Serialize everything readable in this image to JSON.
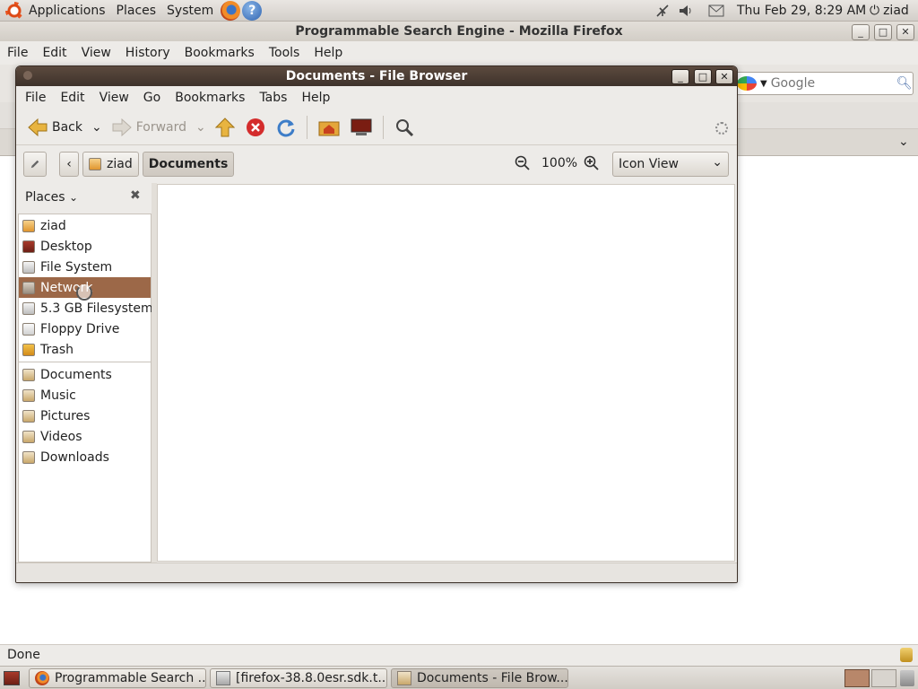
{
  "top_panel": {
    "menus": [
      "Applications",
      "Places",
      "System"
    ],
    "clock": "Thu Feb 29,  8:29 AM",
    "user": "ziad"
  },
  "firefox": {
    "title": "Programmable Search Engine - Mozilla Firefox",
    "menu": [
      "File",
      "Edit",
      "View",
      "History",
      "Bookmarks",
      "Tools",
      "Help"
    ],
    "search_placeholder": "Google",
    "status": "Done"
  },
  "file_browser": {
    "title": "Documents - File Browser",
    "menu": [
      "File",
      "Edit",
      "View",
      "Go",
      "Bookmarks",
      "Tabs",
      "Help"
    ],
    "toolbar": {
      "back": "Back",
      "forward": "Forward"
    },
    "location": {
      "parent": "ziad",
      "current": "Documents"
    },
    "zoom": "100%",
    "view_mode": "Icon View",
    "sidebar_title": "Places",
    "places": [
      {
        "label": "ziad",
        "icon": "home-folder-icon"
      },
      {
        "label": "Desktop",
        "icon": "desktop-icon"
      },
      {
        "label": "File System",
        "icon": "harddrive-icon"
      },
      {
        "label": "Network",
        "icon": "network-icon",
        "selected": true
      },
      {
        "label": "5.3 GB Filesystem",
        "icon": "harddrive-icon"
      },
      {
        "label": "Floppy Drive",
        "icon": "floppy-icon"
      },
      {
        "label": "Trash",
        "icon": "trash-icon"
      }
    ],
    "bookmarks": [
      {
        "label": "Documents",
        "icon": "folder-icon"
      },
      {
        "label": "Music",
        "icon": "folder-icon"
      },
      {
        "label": "Pictures",
        "icon": "folder-icon"
      },
      {
        "label": "Videos",
        "icon": "folder-icon"
      },
      {
        "label": "Downloads",
        "icon": "folder-icon"
      }
    ]
  },
  "taskbar": [
    {
      "label": "Programmable Search ...",
      "active": false
    },
    {
      "label": "[firefox-38.8.0esr.sdk.t...",
      "active": false
    },
    {
      "label": "Documents - File Brow...",
      "active": true
    }
  ]
}
